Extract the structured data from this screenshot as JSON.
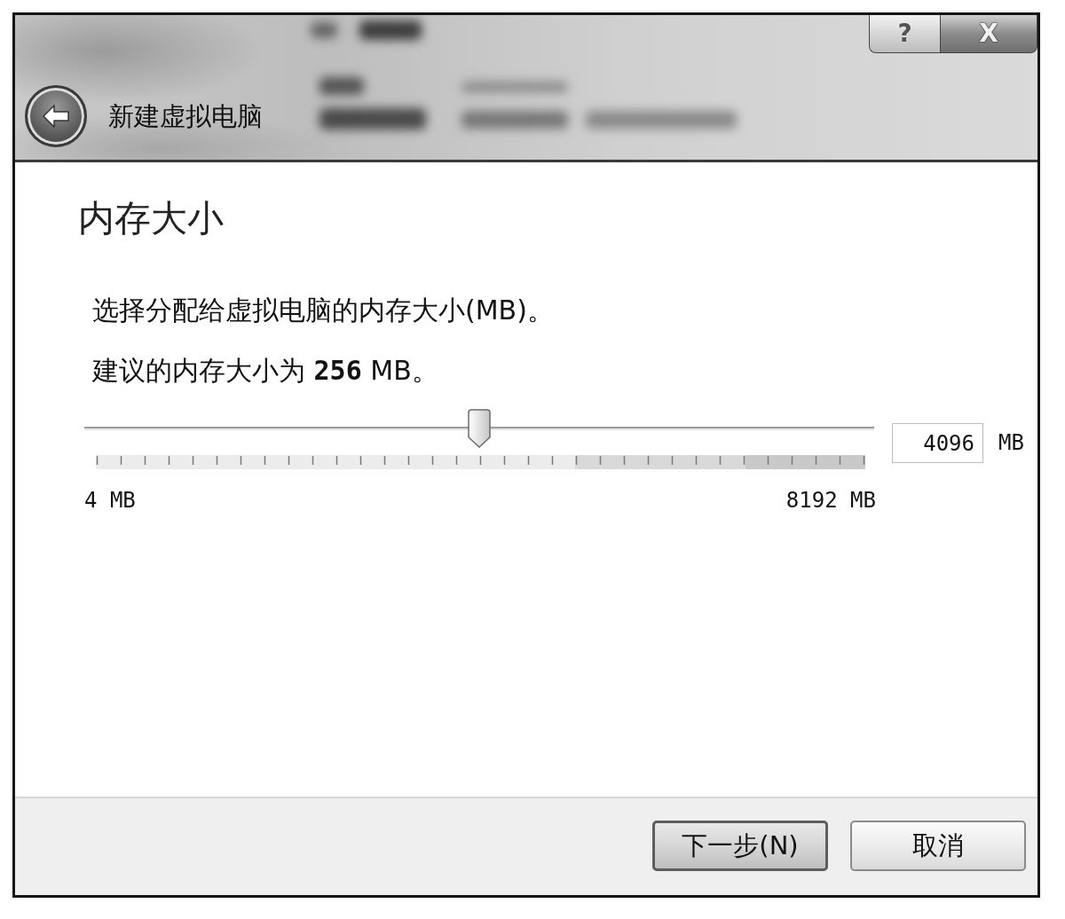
{
  "window": {
    "title": "新建虚拟电脑",
    "title_buttons": [
      {
        "kind": "help",
        "label": "?"
      },
      {
        "kind": "close",
        "label": "X"
      }
    ]
  },
  "page": {
    "heading": "内存大小",
    "description": "选择分配给虚拟电脑的内存大小(MB)。",
    "recommendation": "建议的内存大小为 **256** MB。"
  },
  "memory_slider": {
    "level": 0.5,
    "min_label": "4 MB",
    "max_label": "8192 MB",
    "value": "4096",
    "unit": "MB"
  },
  "buttons": [
    {
      "label": "下一步(N)",
      "default": true
    },
    {
      "label": "取消",
      "default": false
    }
  ]
}
